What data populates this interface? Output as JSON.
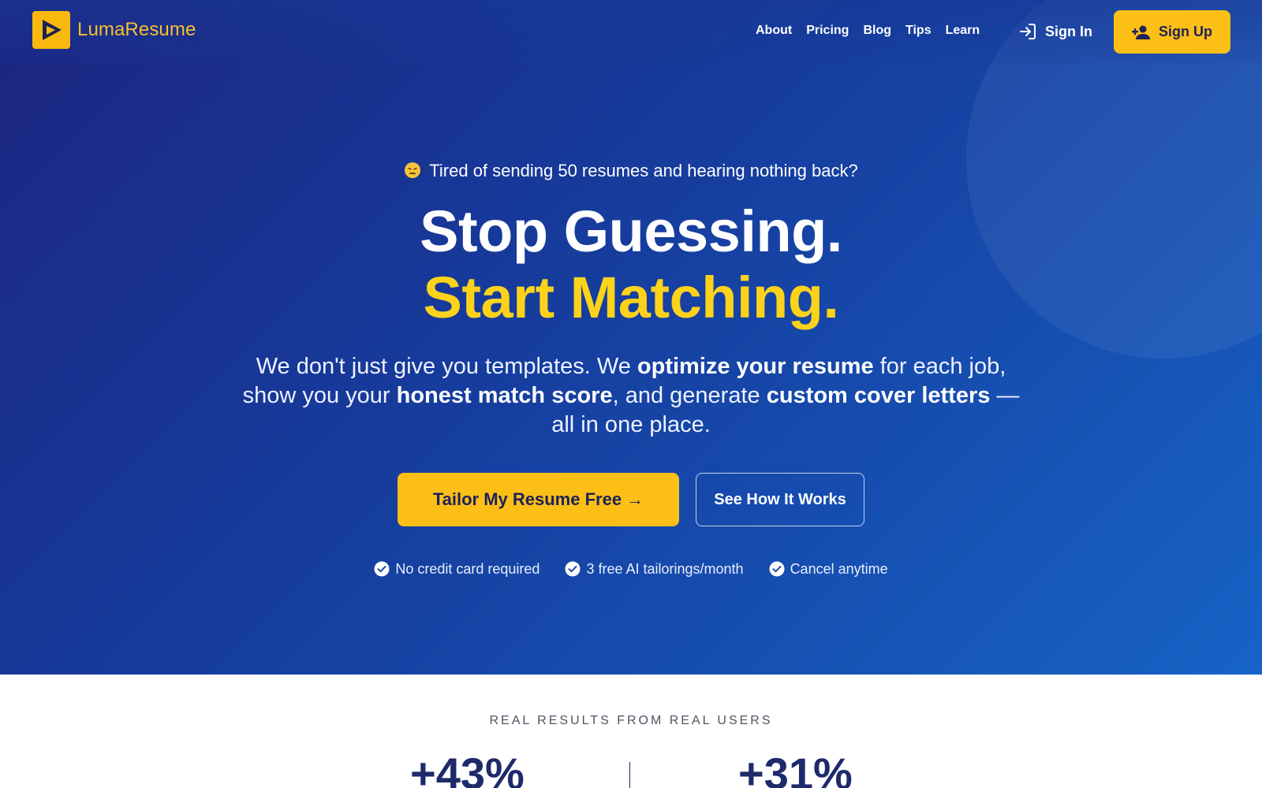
{
  "brand": {
    "name": "LumaResume",
    "logo_icon": "play-triangle-logo",
    "accent_color": "#fbbf16"
  },
  "nav": {
    "links": [
      "About",
      "Pricing",
      "Blog",
      "Tips",
      "Learn"
    ],
    "signin_label": "Sign In",
    "signin_icon": "login-arrow-icon",
    "signup_label": "Sign Up",
    "signup_icon": "add-user-icon"
  },
  "hero": {
    "tagline_emoji": "weary-face-emoji",
    "tagline": "Tired of sending 50 resumes and hearing nothing back?",
    "headline_line1": "Stop Guessing.",
    "headline_line2": "Start Matching.",
    "subcopy": {
      "p1": "We don't just give you templates. We ",
      "b1": "optimize your resume",
      "p2": " for each job, show you your ",
      "b2": "honest match score",
      "p3": ", and generate ",
      "b3": "custom cover letters",
      "p4": " — all in one place."
    },
    "cta_primary": "Tailor My Resume Free →",
    "cta_secondary": "See How It Works",
    "perks": [
      "No credit card required",
      "3 free AI tailorings/month",
      "Cancel anytime"
    ],
    "perk_icon": "check-circle-icon",
    "gradient_colors": [
      "#1c2580",
      "#163d9e",
      "#1763c6"
    ],
    "headline_accent_color": "#fcd21b"
  },
  "results": {
    "label": "REAL RESULTS FROM REAL USERS",
    "stats": [
      "+43%",
      "+31%"
    ]
  }
}
